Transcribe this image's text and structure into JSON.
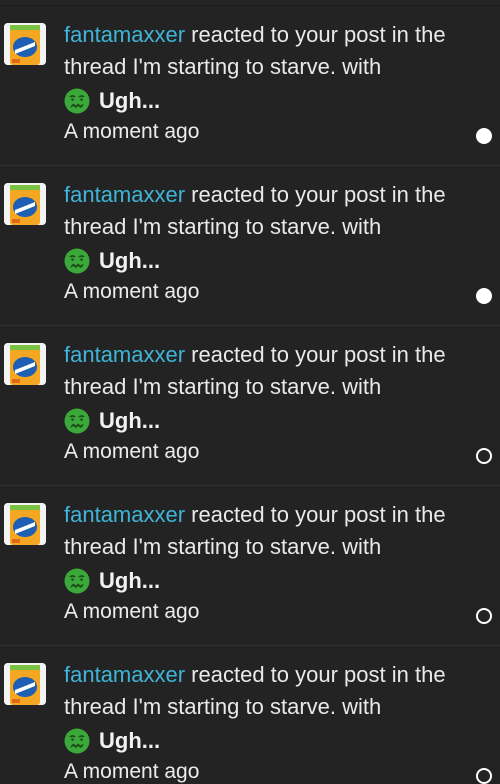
{
  "alerts": [
    {
      "username": "fantamaxxer",
      "text_before": " reacted to your post in the thread ",
      "thread_title": "I'm starting to starve.",
      "text_after": " with",
      "reaction_icon": "nauseated-face-icon",
      "reaction_name": "Ugh...",
      "timestamp": "A moment ago",
      "status": "unread"
    },
    {
      "username": "fantamaxxer",
      "text_before": " reacted to your post in the thread ",
      "thread_title": "I'm starting to starve.",
      "text_after": " with",
      "reaction_icon": "nauseated-face-icon",
      "reaction_name": "Ugh...",
      "timestamp": "A moment ago",
      "status": "unread"
    },
    {
      "username": "fantamaxxer",
      "text_before": " reacted to your post in the thread ",
      "thread_title": "I'm starting to starve.",
      "text_after": " with",
      "reaction_icon": "nauseated-face-icon",
      "reaction_name": "Ugh...",
      "timestamp": "A moment ago",
      "status": "read"
    },
    {
      "username": "fantamaxxer",
      "text_before": " reacted to your post in the thread ",
      "thread_title": "I'm starting to starve.",
      "text_after": " with",
      "reaction_icon": "nauseated-face-icon",
      "reaction_name": "Ugh...",
      "timestamp": "A moment ago",
      "status": "read"
    },
    {
      "username": "fantamaxxer",
      "text_before": " reacted to your post in the thread ",
      "thread_title": "I'm starting to starve.",
      "text_after": " with",
      "reaction_icon": "nauseated-face-icon",
      "reaction_name": "Ugh...",
      "timestamp": "A moment ago",
      "status": "read"
    }
  ],
  "colors": {
    "background": "#232323",
    "username": "#3fb5d8",
    "text": "#e9e9e9",
    "reaction_face": "#3da83a"
  }
}
